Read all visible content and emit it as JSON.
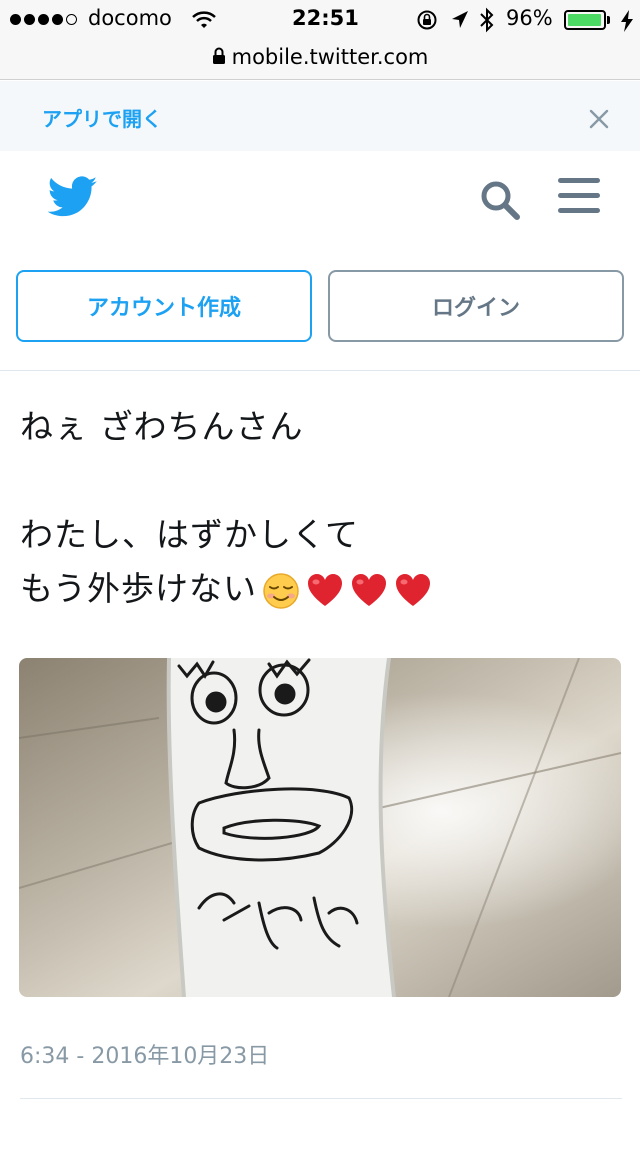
{
  "status_bar": {
    "signal_bars_filled": 4,
    "signal_bars_total": 5,
    "carrier": "docomo",
    "time": "22:51",
    "battery_percent": "96%",
    "icons": [
      "wifi-icon",
      "orientation-lock-icon",
      "location-arrow-icon",
      "bluetooth-icon",
      "battery-icon",
      "charging-bolt-icon"
    ]
  },
  "browser": {
    "url": "mobile.twitter.com",
    "lock_icon": "lock-icon"
  },
  "app_banner": {
    "open_in_app_label": "アプリで開く",
    "close_icon": "close-icon"
  },
  "header": {
    "logo_icon": "twitter-bird-icon",
    "search_icon": "search-icon",
    "menu_icon": "hamburger-menu-icon"
  },
  "auth": {
    "signup_label": "アカウント作成",
    "login_label": "ログイン"
  },
  "tweet": {
    "text": "ねぇ ざわちんさん\n\nわたし、はずかしくて\nもう外歩けない",
    "emoji": [
      "☺️",
      "❤️",
      "❤️",
      "❤️"
    ],
    "timestamp": "6:34 - 2016年10月23日"
  },
  "colors": {
    "brand": "#1da1f2",
    "muted": "#8899a6",
    "banner_bg": "#f5f8fa",
    "battery_fill": "#4cd964"
  }
}
